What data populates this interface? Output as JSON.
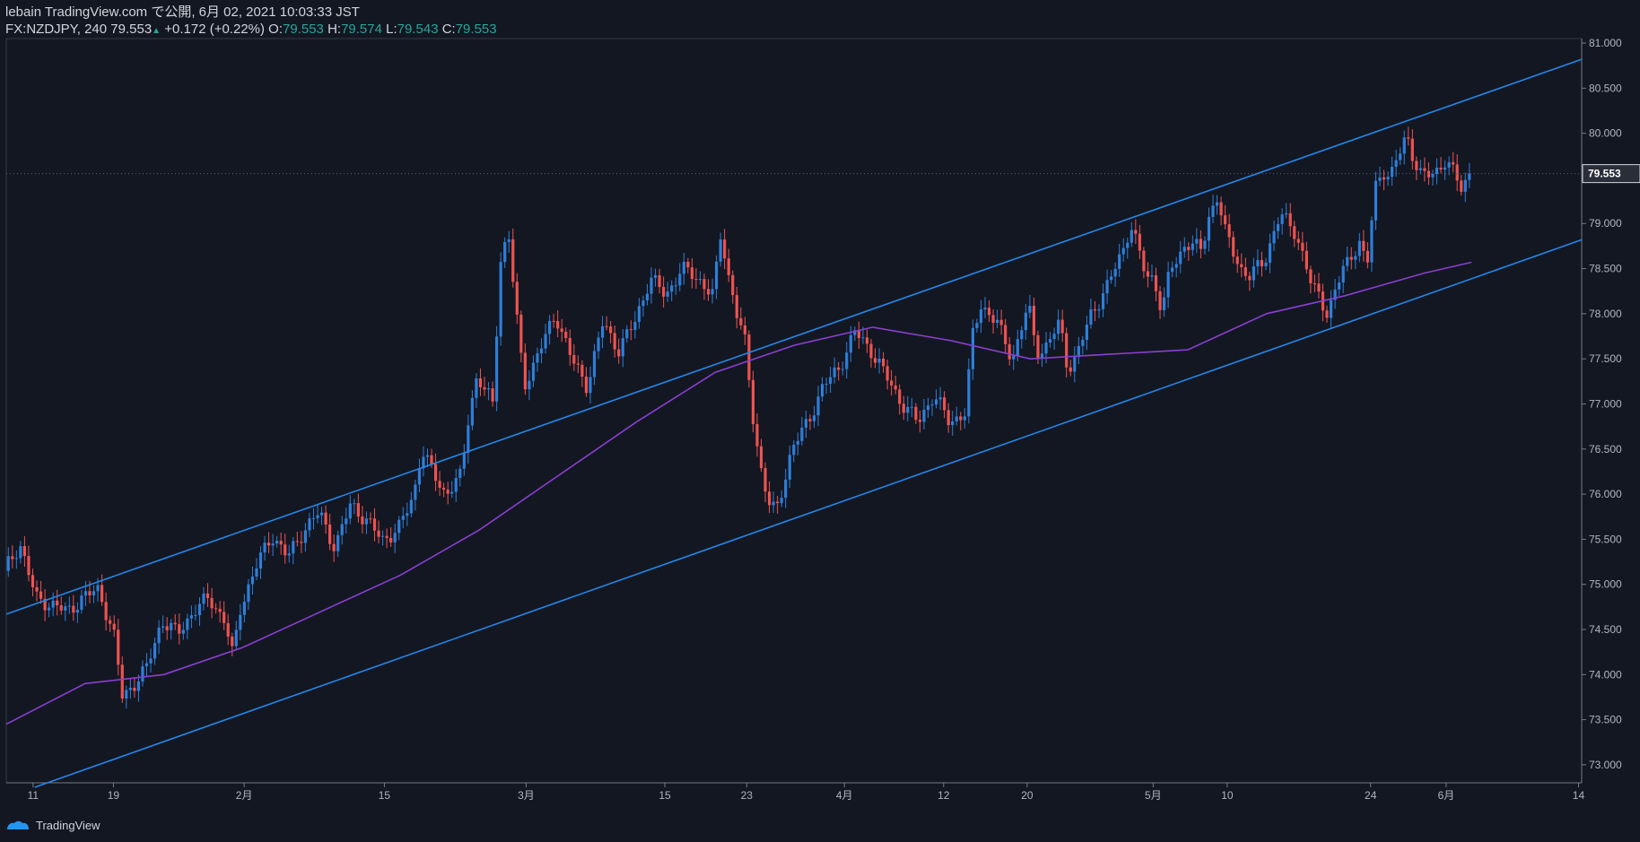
{
  "header": {
    "line1": "lebain TradingView.com で公開, 6月 02, 2021 10:03:33 JST",
    "symbol": "FX:NZDJPY, 240",
    "last": "79.553",
    "change": "+0.172 (+0.22%)",
    "o_label": "O:",
    "o_value": "79.553",
    "h_label": "H:",
    "h_value": "79.574",
    "l_label": "L:",
    "l_value": "79.543",
    "c_label": "C:",
    "c_value": "79.553"
  },
  "footer": {
    "brand": "TradingView"
  },
  "colors": {
    "background": "#131722",
    "up": "#2d7fd9",
    "down": "#ef5350",
    "channel": "#2486e8",
    "ma": "#8a3fd1",
    "axis": "#787b86",
    "price_badge": "#2a2e39"
  },
  "chart_data": {
    "type": "candlestick",
    "symbol": "FX:NZDJPY",
    "timeframe": "240",
    "y_range": [
      72.8,
      81.05
    ],
    "y_ticks": [
      "73.000",
      "73.500",
      "74.000",
      "74.500",
      "75.000",
      "75.500",
      "76.000",
      "76.500",
      "77.000",
      "77.500",
      "78.000",
      "78.500",
      "79.000",
      "79.500",
      "80.000",
      "80.500",
      "81.000"
    ],
    "last_price_label": "79.553",
    "x_ticks": [
      "11",
      "19",
      "2月",
      "15",
      "3月",
      "15",
      "23",
      "4月",
      "12",
      "20",
      "5月",
      "10",
      "24",
      "6月",
      "14"
    ],
    "closes": [
      [
        0.0,
        75.15
      ],
      [
        0.01,
        75.45
      ],
      [
        0.02,
        74.85
      ],
      [
        0.04,
        74.7
      ],
      [
        0.05,
        74.85
      ],
      [
        0.06,
        74.95
      ],
      [
        0.07,
        74.4
      ],
      [
        0.075,
        73.75
      ],
      [
        0.08,
        73.85
      ],
      [
        0.09,
        74.05
      ],
      [
        0.1,
        74.6
      ],
      [
        0.11,
        74.45
      ],
      [
        0.12,
        74.7
      ],
      [
        0.13,
        74.85
      ],
      [
        0.14,
        74.6
      ],
      [
        0.145,
        74.2
      ],
      [
        0.15,
        74.75
      ],
      [
        0.16,
        75.2
      ],
      [
        0.17,
        75.55
      ],
      [
        0.18,
        75.3
      ],
      [
        0.19,
        75.6
      ],
      [
        0.2,
        75.8
      ],
      [
        0.21,
        75.4
      ],
      [
        0.22,
        75.9
      ],
      [
        0.23,
        75.7
      ],
      [
        0.24,
        75.5
      ],
      [
        0.25,
        75.6
      ],
      [
        0.26,
        76.0
      ],
      [
        0.265,
        76.5
      ],
      [
        0.27,
        76.3
      ],
      [
        0.28,
        76.0
      ],
      [
        0.29,
        76.2
      ],
      [
        0.295,
        76.9
      ],
      [
        0.3,
        77.3
      ],
      [
        0.31,
        77.0
      ],
      [
        0.315,
        78.6
      ],
      [
        0.32,
        78.9
      ],
      [
        0.325,
        78.0
      ],
      [
        0.33,
        77.2
      ],
      [
        0.34,
        77.6
      ],
      [
        0.35,
        78.0
      ],
      [
        0.36,
        77.5
      ],
      [
        0.37,
        77.2
      ],
      [
        0.38,
        77.9
      ],
      [
        0.39,
        77.6
      ],
      [
        0.4,
        77.9
      ],
      [
        0.41,
        78.4
      ],
      [
        0.42,
        78.2
      ],
      [
        0.43,
        78.5
      ],
      [
        0.44,
        78.4
      ],
      [
        0.45,
        78.2
      ],
      [
        0.455,
        78.9
      ],
      [
        0.46,
        78.4
      ],
      [
        0.465,
        78.0
      ],
      [
        0.47,
        77.7
      ],
      [
        0.475,
        76.9
      ],
      [
        0.48,
        76.3
      ],
      [
        0.485,
        75.9
      ],
      [
        0.49,
        75.8
      ],
      [
        0.5,
        76.5
      ],
      [
        0.51,
        76.8
      ],
      [
        0.52,
        77.2
      ],
      [
        0.53,
        77.4
      ],
      [
        0.54,
        77.8
      ],
      [
        0.55,
        77.6
      ],
      [
        0.56,
        77.3
      ],
      [
        0.57,
        77.0
      ],
      [
        0.58,
        76.8
      ],
      [
        0.59,
        77.1
      ],
      [
        0.6,
        76.8
      ],
      [
        0.61,
        76.9
      ],
      [
        0.615,
        77.8
      ],
      [
        0.62,
        78.1
      ],
      [
        0.63,
        77.9
      ],
      [
        0.64,
        77.5
      ],
      [
        0.65,
        78.1
      ],
      [
        0.655,
        77.6
      ],
      [
        0.66,
        77.6
      ],
      [
        0.67,
        77.9
      ],
      [
        0.675,
        77.4
      ],
      [
        0.68,
        77.5
      ],
      [
        0.69,
        78.0
      ],
      [
        0.7,
        78.3
      ],
      [
        0.71,
        78.7
      ],
      [
        0.715,
        79.0
      ],
      [
        0.72,
        78.7
      ],
      [
        0.725,
        78.4
      ],
      [
        0.73,
        78.4
      ],
      [
        0.735,
        78.0
      ],
      [
        0.74,
        78.5
      ],
      [
        0.745,
        78.6
      ],
      [
        0.75,
        78.8
      ],
      [
        0.76,
        78.7
      ],
      [
        0.765,
        79.1
      ],
      [
        0.77,
        79.3
      ],
      [
        0.775,
        78.9
      ],
      [
        0.78,
        78.7
      ],
      [
        0.785,
        78.5
      ],
      [
        0.79,
        78.4
      ],
      [
        0.8,
        78.6
      ],
      [
        0.81,
        79.1
      ],
      [
        0.82,
        78.9
      ],
      [
        0.825,
        78.6
      ],
      [
        0.83,
        78.3
      ],
      [
        0.835,
        78.2
      ],
      [
        0.84,
        78.0
      ],
      [
        0.85,
        78.5
      ],
      [
        0.86,
        78.8
      ],
      [
        0.865,
        78.5
      ],
      [
        0.87,
        79.4
      ],
      [
        0.875,
        79.6
      ],
      [
        0.88,
        79.5
      ],
      [
        0.89,
        80.0
      ],
      [
        0.895,
        79.7
      ],
      [
        0.9,
        79.5
      ],
      [
        0.91,
        79.6
      ],
      [
        0.915,
        79.7
      ],
      [
        0.92,
        79.55
      ],
      [
        0.925,
        79.4
      ],
      [
        0.93,
        79.553
      ]
    ],
    "ma_series": [
      [
        0.0,
        73.45
      ],
      [
        0.05,
        73.9
      ],
      [
        0.1,
        74.0
      ],
      [
        0.15,
        74.3
      ],
      [
        0.2,
        74.7
      ],
      [
        0.25,
        75.1
      ],
      [
        0.3,
        75.6
      ],
      [
        0.35,
        76.2
      ],
      [
        0.4,
        76.8
      ],
      [
        0.45,
        77.35
      ],
      [
        0.5,
        77.65
      ],
      [
        0.55,
        77.85
      ],
      [
        0.6,
        77.7
      ],
      [
        0.65,
        77.5
      ],
      [
        0.7,
        77.55
      ],
      [
        0.75,
        77.6
      ],
      [
        0.8,
        78.0
      ],
      [
        0.85,
        78.2
      ],
      [
        0.9,
        78.45
      ],
      [
        0.93,
        78.57
      ]
    ],
    "channel_lines": [
      {
        "from": [
          0.0,
          74.67
        ],
        "to": [
          1.0,
          80.82
        ]
      },
      {
        "from": [
          0.018,
          72.75
        ],
        "to": [
          1.0,
          78.82
        ]
      }
    ]
  }
}
